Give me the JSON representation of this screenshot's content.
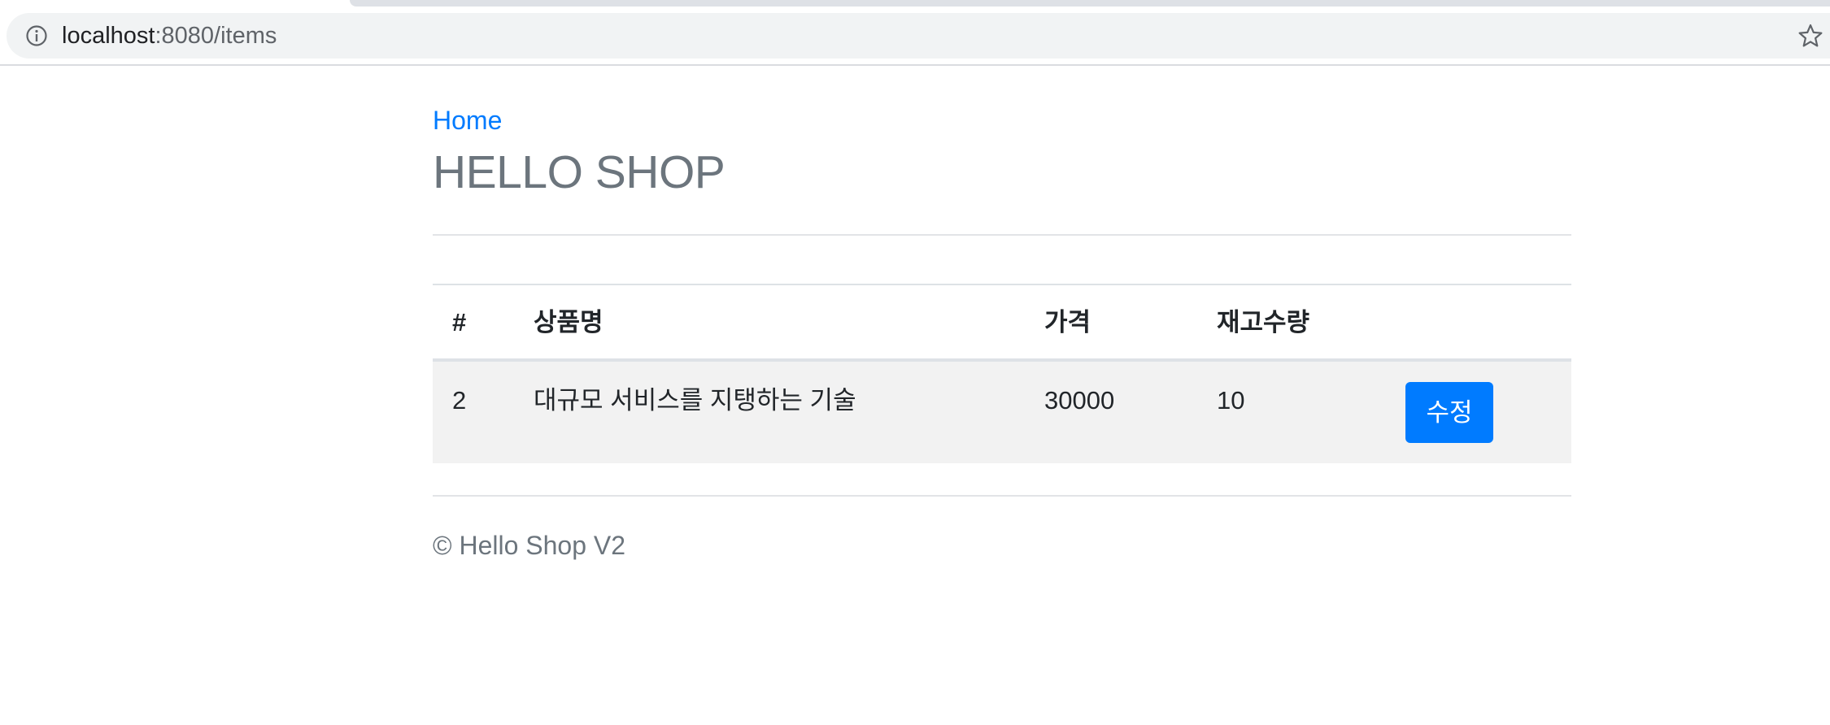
{
  "browser": {
    "url_host": "localhost",
    "url_rest": ":8080/items",
    "icons": {
      "info": "info-icon",
      "bookmark": "star-icon"
    }
  },
  "nav": {
    "home_label": "Home"
  },
  "header": {
    "title": "HELLO SHOP"
  },
  "table": {
    "columns": [
      "#",
      "상품명",
      "가격",
      "재고수량"
    ],
    "rows": [
      {
        "id": "2",
        "name": "대규모 서비스를 지탱하는 기술",
        "price": "30000",
        "stock": "10",
        "action_label": "수정"
      }
    ]
  },
  "footer": {
    "text": "© Hello Shop V2"
  },
  "colors": {
    "link": "#007bff",
    "button": "#007bff",
    "title": "#6c757d",
    "row_background": "#f2f2f2"
  }
}
